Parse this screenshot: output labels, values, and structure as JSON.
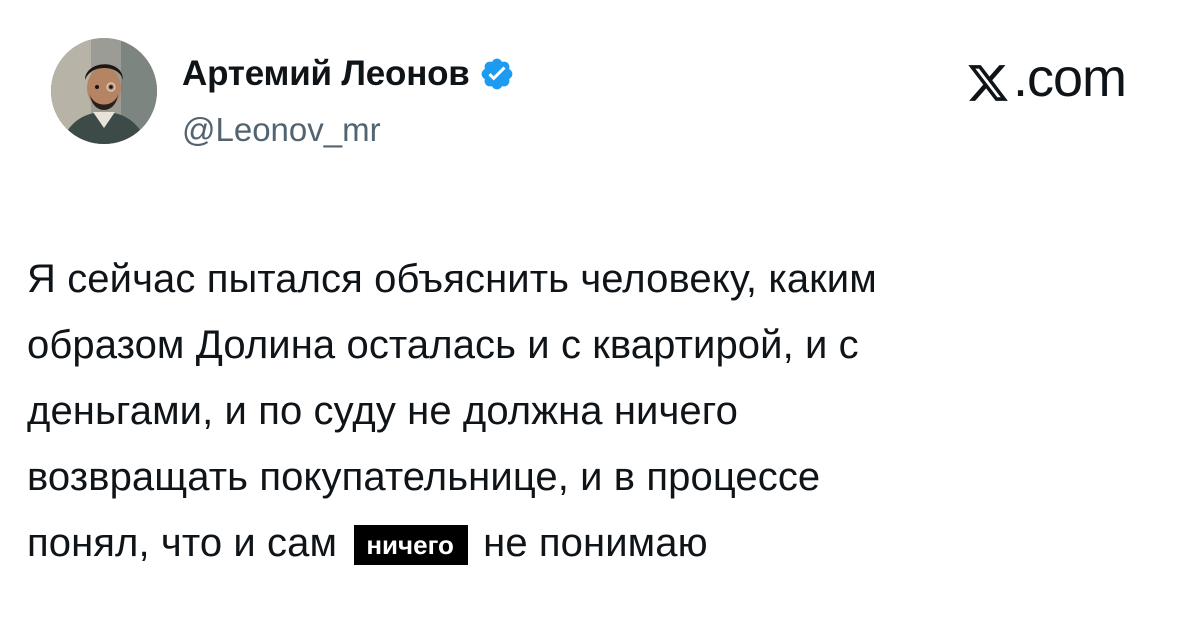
{
  "author": {
    "name": "Артемий Леонов",
    "handle": "@Leonov_mr",
    "verified": true,
    "verified_color": "#1d9bf0"
  },
  "site": {
    "logo_icon": "x-logo-icon",
    "logo_text": ".com"
  },
  "tweet": {
    "lines": [
      "Я сейчас пытался объяснить человеку, каким",
      "образом Долина осталась и с квартирой, и с",
      "деньгами, и по суду не должна ничего",
      "возвращать покупательнице, и в процессе"
    ],
    "last_line_before": "понял, что и сам",
    "highlight": "ничего",
    "last_line_after": "не понимаю"
  },
  "colors": {
    "text": "#0f1419",
    "handle": "#536471",
    "highlight_bg": "#000000",
    "highlight_text": "#ffffff"
  }
}
